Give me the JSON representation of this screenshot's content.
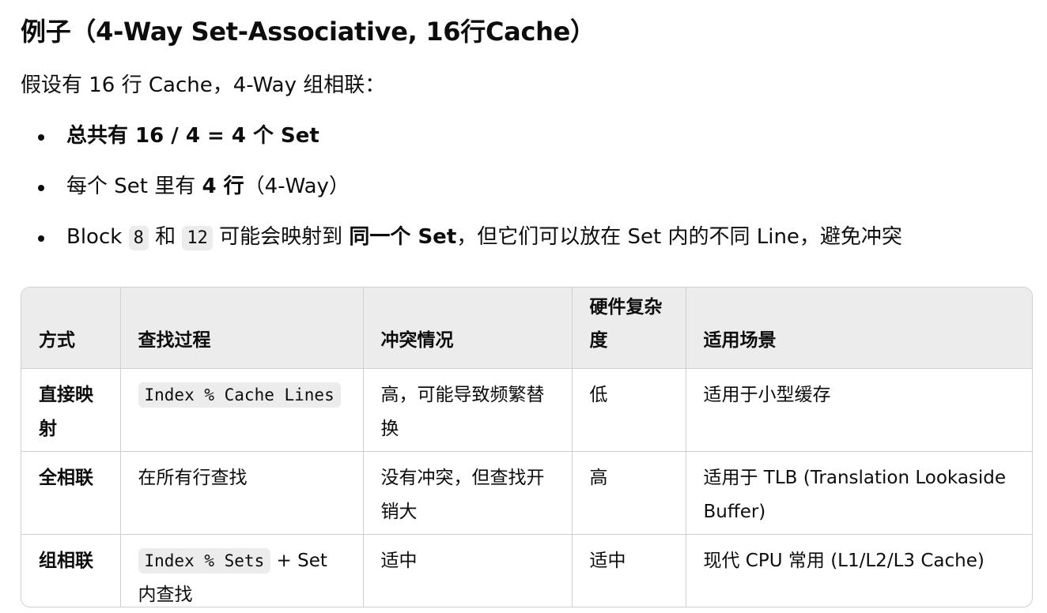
{
  "heading": "例子（4-Way Set-Associative, 16行Cache）",
  "intro": "假设有 16 行 Cache，4-Way 组相联：",
  "bullets": {
    "b1": "总共有 16 / 4 = 4 个 Set",
    "b2_pre": "每个 Set 里有 ",
    "b2_bold": "4 行",
    "b2_post": "（4-Way）",
    "b3_pre": "Block ",
    "b3_code1": "8",
    "b3_mid": " 和 ",
    "b3_code2": "12",
    "b3_mid2": " 可能会映射到 ",
    "b3_bold": "同一个 Set",
    "b3_post": "，但它们可以放在 Set 内的不同 Line，避免冲突"
  },
  "table": {
    "headers": [
      "方式",
      "查找过程",
      "冲突情况",
      "硬件复杂度",
      "适用场景"
    ],
    "rows": [
      {
        "method": "直接映射",
        "lookup_code": "Index % Cache Lines",
        "lookup_text": "",
        "conflict": "高，可能导致频繁替换",
        "complexity": "低",
        "usage": "适用于小型缓存"
      },
      {
        "method": "全相联",
        "lookup_code": "",
        "lookup_text": "在所有行查找",
        "conflict": "没有冲突，但查找开销大",
        "complexity": "高",
        "usage": "适用于 TLB (Translation Lookaside Buffer)"
      },
      {
        "method": "组相联",
        "lookup_code": "Index % Sets",
        "lookup_text": " + Set 内查找",
        "conflict": "适中",
        "complexity": "适中",
        "usage": "现代 CPU 常用 (L1/L2/L3 Cache)"
      }
    ]
  }
}
